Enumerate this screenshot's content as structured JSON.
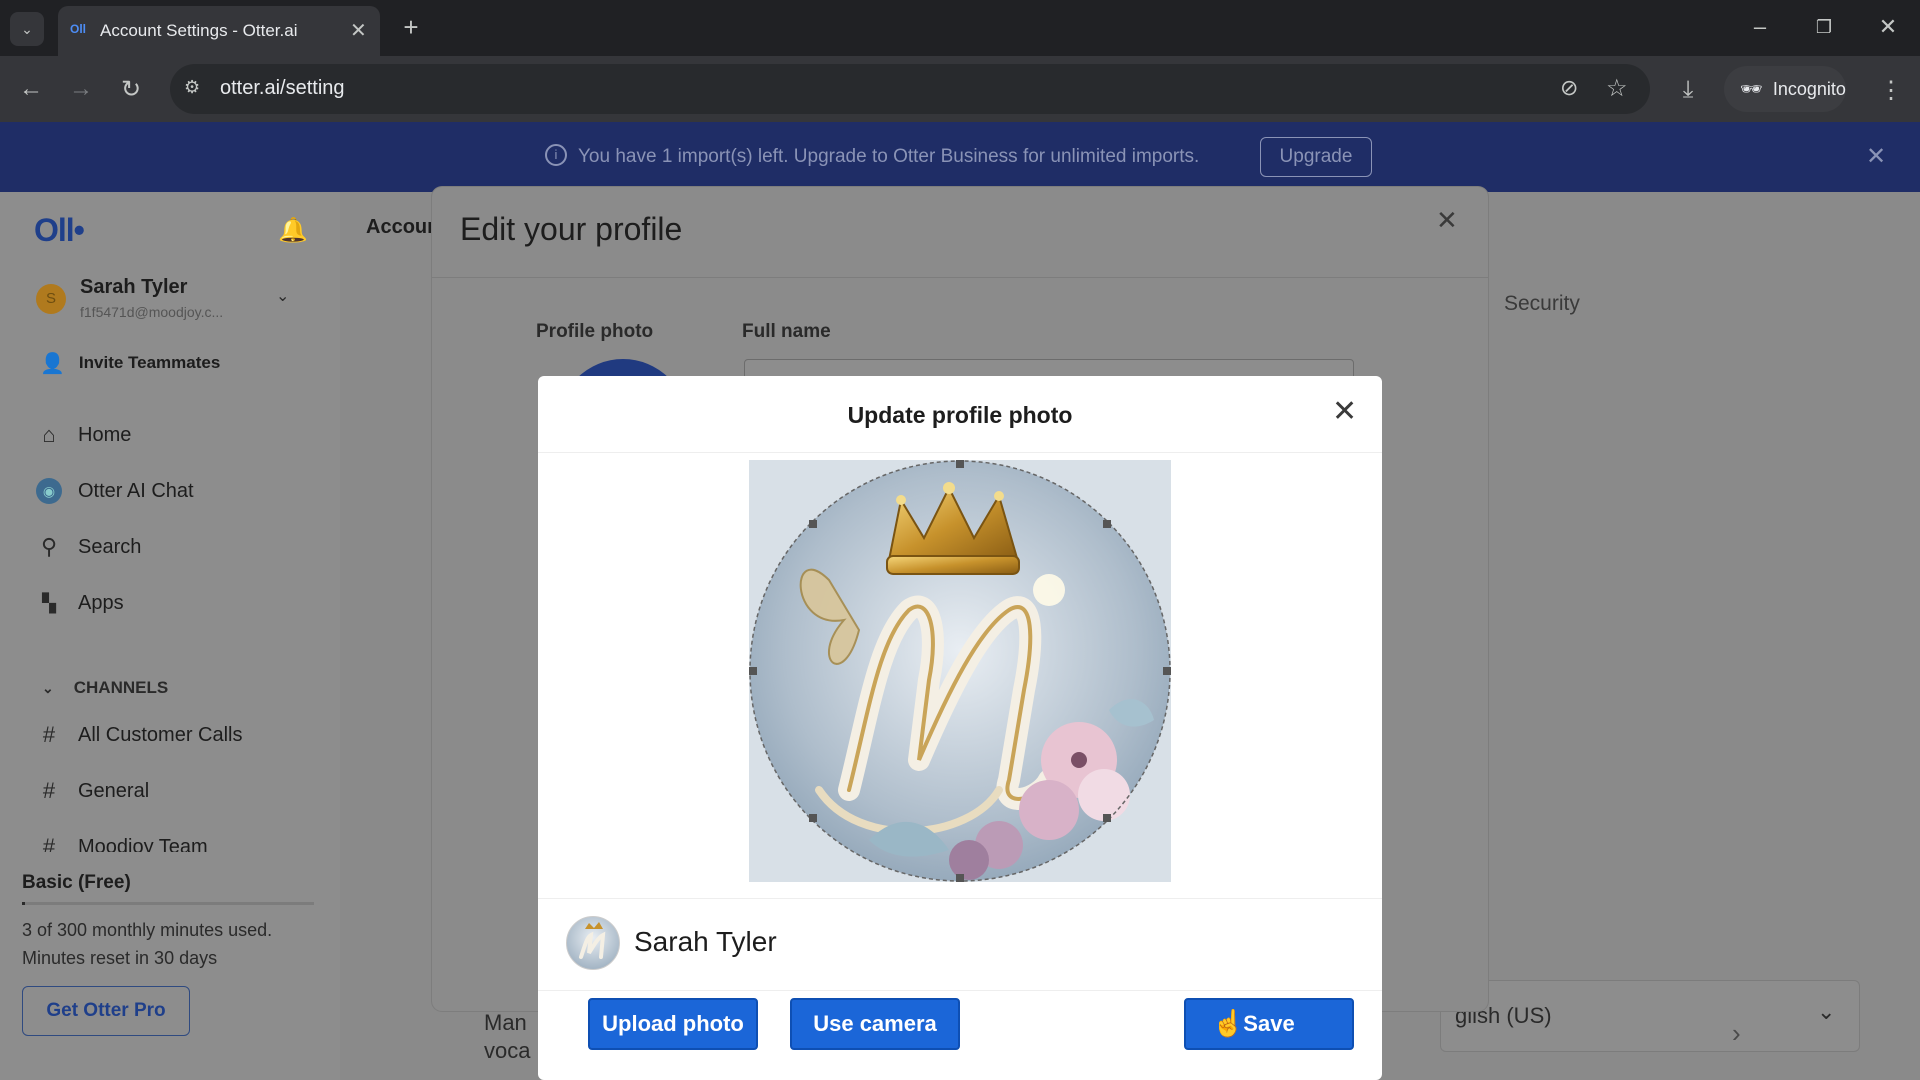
{
  "browser": {
    "tab_title": "Account Settings - Otter.ai",
    "url": "otter.ai/setting",
    "incognito_label": "Incognito"
  },
  "banner": {
    "message": "You have 1 import(s) left. Upgrade to Otter Business for unlimited imports.",
    "upgrade_label": "Upgrade"
  },
  "sidebar": {
    "logo": "Oll•",
    "user_name": "Sarah Tyler",
    "user_email": "f1f5471d@moodjoy.c...",
    "avatar_initial": "S",
    "invite_label": "Invite Teammates",
    "nav": [
      {
        "label": "Home",
        "icon": "home-icon"
      },
      {
        "label": "Otter AI Chat",
        "icon": "otter-chat-icon"
      },
      {
        "label": "Search",
        "icon": "search-icon"
      },
      {
        "label": "Apps",
        "icon": "apps-icon"
      }
    ],
    "channels_heading": "CHANNELS",
    "channels": [
      "All Customer Calls",
      "General",
      "Moodjoy Team"
    ],
    "plan_name": "Basic (Free)",
    "usage_line1": "3 of 300 monthly minutes used.",
    "usage_line2": "Minutes reset in 30 days",
    "usage_fraction": 0.01,
    "get_pro_label": "Get Otter Pro"
  },
  "background_page": {
    "heading_partial": "Accoun",
    "security_tab": "Security",
    "language_value": "glish (US)",
    "bottom_partial_1": "Man",
    "bottom_partial_2": "voca"
  },
  "edit_profile": {
    "title": "Edit your profile",
    "profile_photo_label": "Profile photo",
    "full_name_label": "Full name"
  },
  "update_photo": {
    "title": "Update profile photo",
    "preview_name": "Sarah Tyler",
    "upload_label": "Upload photo",
    "camera_label": "Use camera",
    "save_label": "Save"
  }
}
